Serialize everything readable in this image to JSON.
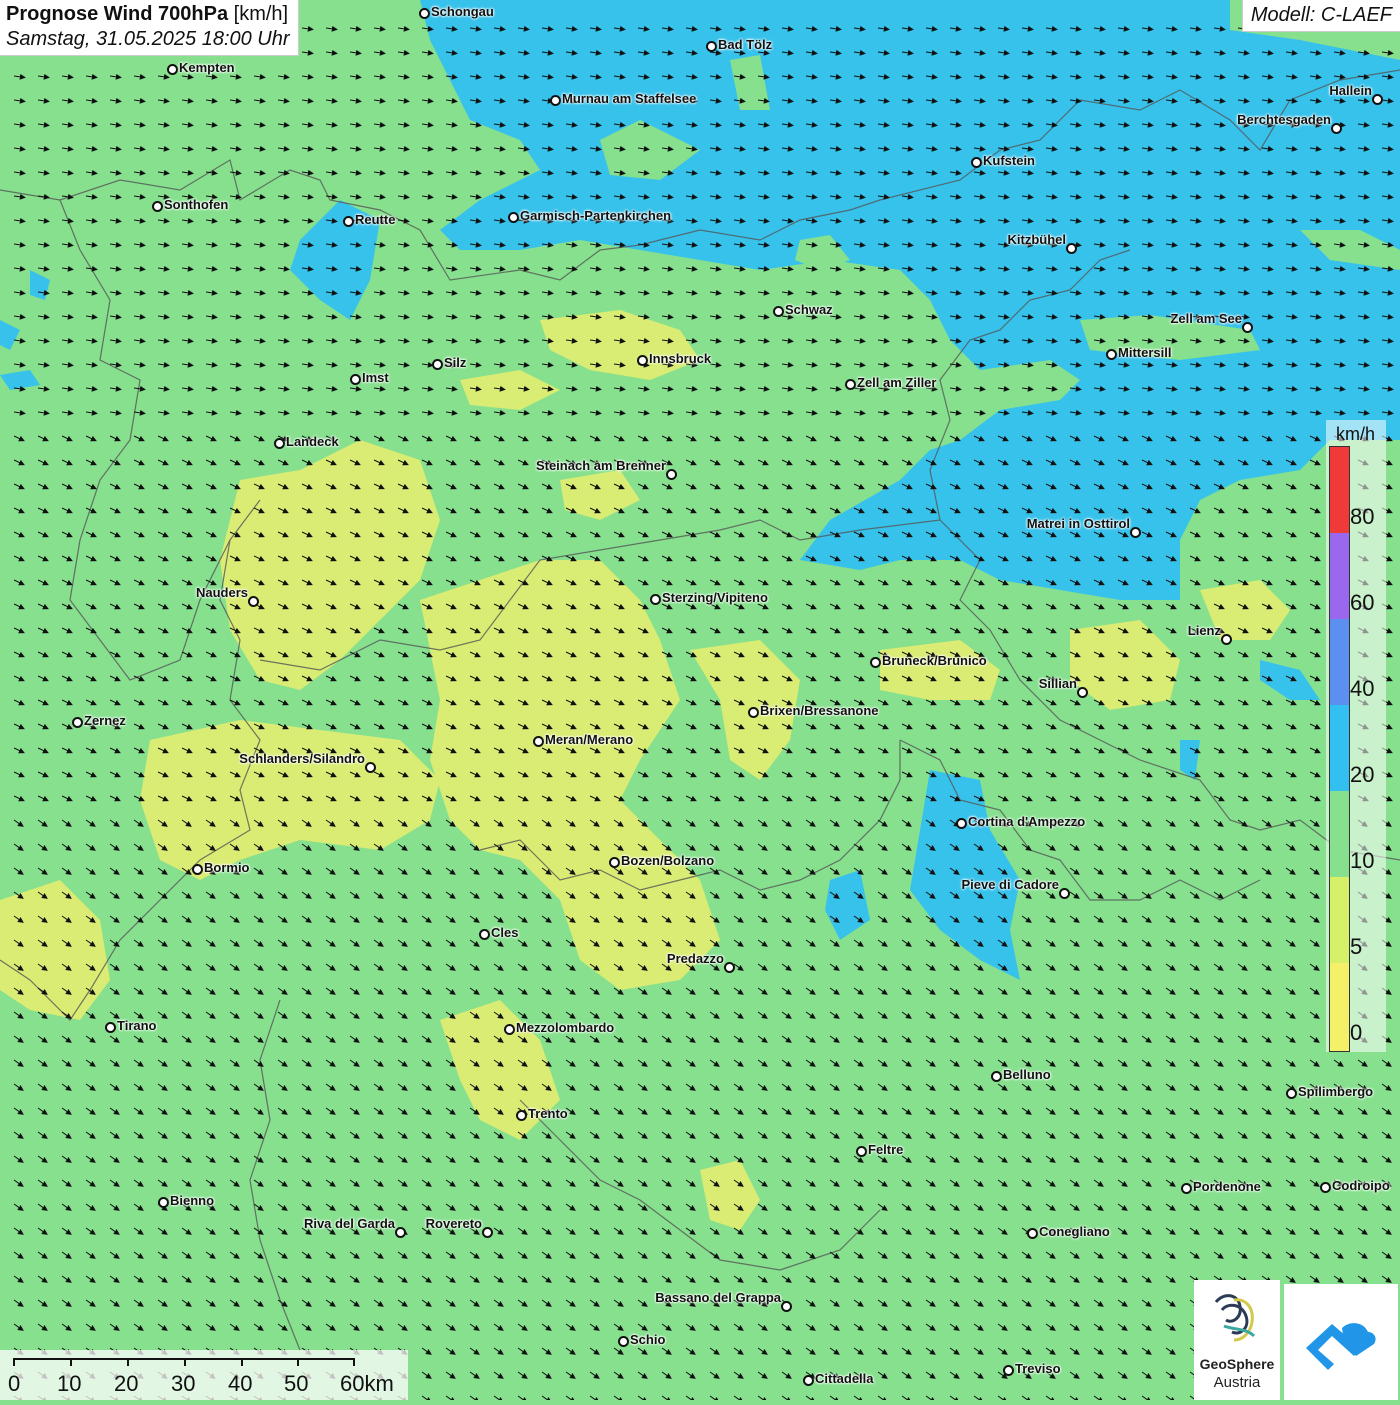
{
  "header": {
    "title": "Prognose Wind 700hPa",
    "unit": "[km/h]",
    "datetime": "Samstag, 31.05.2025 18:00 Uhr",
    "model": "Modell: C-LAEF"
  },
  "legend": {
    "unit": "km/h",
    "stops": [
      {
        "label": "80",
        "color": "#f03a3a"
      },
      {
        "label": "60",
        "color": "#9a68ee"
      },
      {
        "label": "40",
        "color": "#5b8ff0"
      },
      {
        "label": "20",
        "color": "#33c0f0"
      },
      {
        "label": "10",
        "color": "#86e08e"
      },
      {
        "label": "5",
        "color": "#d6f06a"
      },
      {
        "label": "0",
        "color": "#f5f06a"
      }
    ]
  },
  "scale": {
    "labels": [
      "0",
      "10",
      "20",
      "30",
      "40",
      "50",
      "60km"
    ]
  },
  "cities": [
    {
      "name": "Schongau"
    },
    {
      "name": "Kempten"
    },
    {
      "name": "Bad Tölz"
    },
    {
      "name": "Murnau am Staffelsee"
    },
    {
      "name": "Hallein"
    },
    {
      "name": "Berchtesgaden"
    },
    {
      "name": "Kufstein"
    },
    {
      "name": "Sonthofen"
    },
    {
      "name": "Reutte"
    },
    {
      "name": "Garmisch-Partenkirchen"
    },
    {
      "name": "Kitzbühel"
    },
    {
      "name": "Schwaz"
    },
    {
      "name": "Zell am See"
    },
    {
      "name": "Mittersill"
    },
    {
      "name": "Innsbruck"
    },
    {
      "name": "Silz"
    },
    {
      "name": "Imst"
    },
    {
      "name": "Zell am Ziller"
    },
    {
      "name": "Landeck"
    },
    {
      "name": "Steinach am Brenner"
    },
    {
      "name": "Matrei in Osttirol"
    },
    {
      "name": "Nauders"
    },
    {
      "name": "Sterzing/Vipiteno"
    },
    {
      "name": "Lienz"
    },
    {
      "name": "Bruneck/Brunico"
    },
    {
      "name": "Sillian"
    },
    {
      "name": "Brixen/Bressanone"
    },
    {
      "name": "Zernez"
    },
    {
      "name": "Meran/Merano"
    },
    {
      "name": "Schlanders/Silandro"
    },
    {
      "name": "Cortina d'Ampezzo"
    },
    {
      "name": "Bozen/Bolzano"
    },
    {
      "name": "Bormio"
    },
    {
      "name": "Pieve di Cadore"
    },
    {
      "name": "Cles"
    },
    {
      "name": "Predazzo"
    },
    {
      "name": "Tirano"
    },
    {
      "name": "Mezzolombardo"
    },
    {
      "name": "Belluno"
    },
    {
      "name": "Spilimbergo"
    },
    {
      "name": "Trento"
    },
    {
      "name": "Feltre"
    },
    {
      "name": "Pordenone"
    },
    {
      "name": "Codroipo"
    },
    {
      "name": "Bienno"
    },
    {
      "name": "Riva del Garda"
    },
    {
      "name": "Rovereto"
    },
    {
      "name": "Conegliano"
    },
    {
      "name": "Bassano del Grappa"
    },
    {
      "name": "Schio"
    },
    {
      "name": "Treviso"
    },
    {
      "name": "Cittadella"
    }
  ],
  "logos": {
    "geosphere_line1": "GeoSphere",
    "geosphere_line2": "Austria"
  },
  "colors": {
    "low_wind": "#f5f06a",
    "mid_wind": "#86e08e",
    "high_wind": "#33c0f0"
  }
}
